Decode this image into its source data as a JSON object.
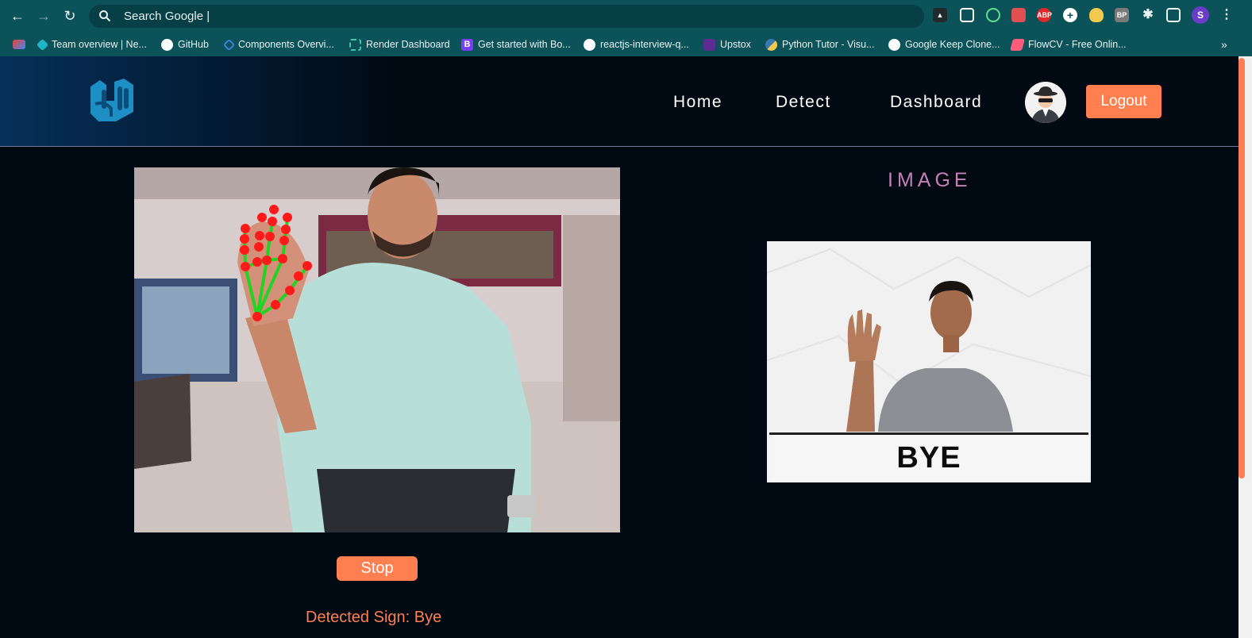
{
  "browser": {
    "omnibox_text": "Search Google |",
    "profile_initial": "S",
    "extensions": [
      "ABP",
      "BP"
    ],
    "bookmarks": [
      {
        "label": "Team overview | Ne...",
        "icon": "diamond-icon",
        "color": "#1fb4c6"
      },
      {
        "label": "GitHub",
        "icon": "github-icon",
        "color": "#ffffff"
      },
      {
        "label": "Components Overvi...",
        "icon": "diamond-outline-icon",
        "color": "#3f7fe0"
      },
      {
        "label": "Render Dashboard",
        "icon": "render-icon",
        "color": "#46c3a8"
      },
      {
        "label": "Get started with Bo...",
        "icon": "bootstrap-icon",
        "color": "#7b3ff2"
      },
      {
        "label": "reactjs-interview-q...",
        "icon": "github-icon",
        "color": "#ffffff"
      },
      {
        "label": "Upstox",
        "icon": "upstox-icon",
        "color": "#5a2d91"
      },
      {
        "label": "Python Tutor - Visu...",
        "icon": "python-icon",
        "color": "#f2c94c"
      },
      {
        "label": "Google Keep Clone...",
        "icon": "globe-icon",
        "color": "#ffffff"
      },
      {
        "label": "FlowCV - Free Onlin...",
        "icon": "flowcv-icon",
        "color": "#ff5c7c"
      }
    ]
  },
  "nav": {
    "links": [
      "Home",
      "Detect",
      "Dashboard"
    ],
    "logout_label": "Logout"
  },
  "main": {
    "stop_label": "Stop",
    "detected_text": "Detected Sign: Bye",
    "image_heading": "IMAGE",
    "sign_caption": "BYE"
  },
  "colors": {
    "accent": "#ff7f50",
    "heading": "#c77fb4",
    "background": "#010a13",
    "chrome": "#0b5259"
  }
}
